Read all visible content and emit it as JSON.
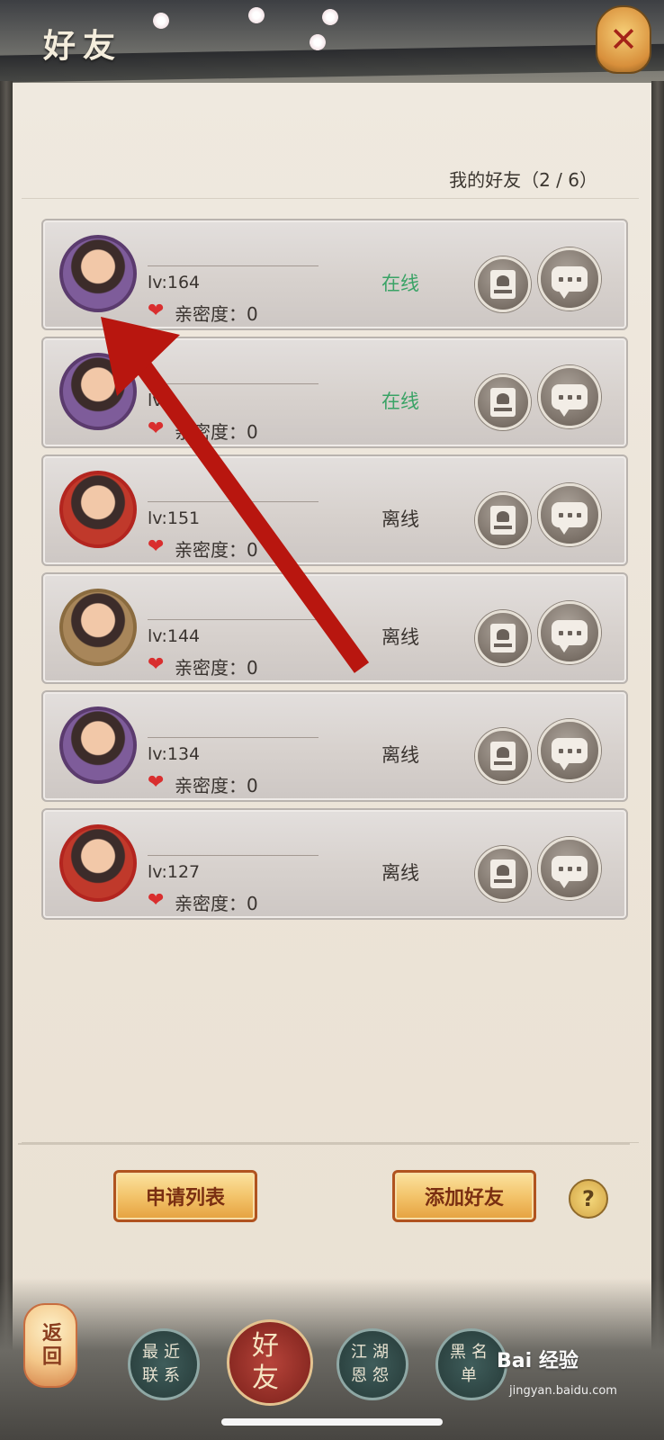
{
  "header": {
    "title": "好友",
    "close_icon": "close-icon"
  },
  "friend_count": "我的好友（2 / 6）",
  "friends": [
    {
      "level": "lv:164",
      "intimacy": "亲密度：0",
      "status": "在线",
      "online": true
    },
    {
      "level": "lv:1",
      "intimacy": "亲密度：0",
      "status": "在线",
      "online": true
    },
    {
      "level": "lv:151",
      "intimacy": "亲密度：0",
      "status": "离线",
      "online": false
    },
    {
      "level": "lv:144",
      "intimacy": "亲密度：0",
      "status": "离线",
      "online": false
    },
    {
      "level": "lv:134",
      "intimacy": "亲密度：0",
      "status": "离线",
      "online": false
    },
    {
      "level": "lv:127",
      "intimacy": "亲密度：0",
      "status": "离线",
      "online": false
    }
  ],
  "buttons": {
    "apply_list": "申请列表",
    "add_friend": "添加好友",
    "help": "?"
  },
  "nav": {
    "back": "返回",
    "recent": "最近联系",
    "friends": "好友",
    "jianghu": "江湖恩怨",
    "blacklist": "黑名单"
  },
  "watermark": {
    "brand": "Bai 经验",
    "url": "jingyan.baidu.com"
  },
  "colors": {
    "online": "#3aa366",
    "accent_red": "#b3251f",
    "button_gold": "#f3c46b"
  }
}
